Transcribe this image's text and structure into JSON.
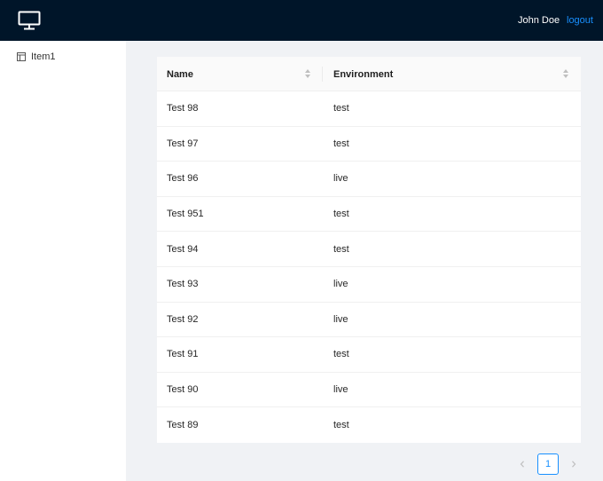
{
  "header": {
    "logo_icon": "monitor-icon",
    "user_name": "John Doe",
    "logout_label": "logout"
  },
  "sidebar": {
    "items": [
      {
        "label": "Item1",
        "icon": "layout-icon"
      }
    ]
  },
  "table": {
    "columns": [
      {
        "label": "Name",
        "sortable": true
      },
      {
        "label": "Environment",
        "sortable": true
      }
    ],
    "rows": [
      {
        "name": "Test 98",
        "environment": "test"
      },
      {
        "name": "Test 97",
        "environment": "test"
      },
      {
        "name": "Test 96",
        "environment": "live"
      },
      {
        "name": "Test 951",
        "environment": "test"
      },
      {
        "name": "Test 94",
        "environment": "test"
      },
      {
        "name": "Test 93",
        "environment": "live"
      },
      {
        "name": "Test 92",
        "environment": "live"
      },
      {
        "name": "Test 91",
        "environment": "test"
      },
      {
        "name": "Test 90",
        "environment": "live"
      },
      {
        "name": "Test 89",
        "environment": "test"
      }
    ]
  },
  "pagination": {
    "current_page": "1",
    "prev_icon": "chevron-left-icon",
    "next_icon": "chevron-right-icon"
  },
  "colors": {
    "header_bg": "#001529",
    "accent": "#1890ff",
    "content_bg": "#f0f2f5"
  }
}
